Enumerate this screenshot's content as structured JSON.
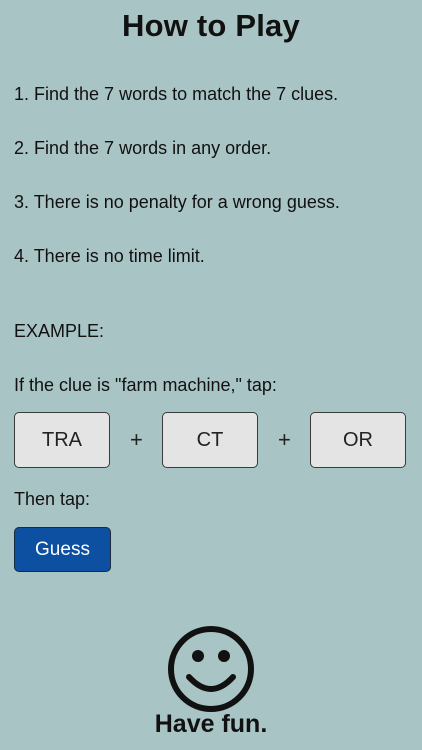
{
  "title": "How to Play",
  "rules": [
    "1. Find the 7 words to match the 7 clues.",
    "2. Find the 7 words in any order.",
    "3. There is no penalty for a wrong guess.",
    "4. There is no time limit."
  ],
  "example": {
    "heading": "EXAMPLE:",
    "clue_line": "If the clue is \"farm machine,\" tap:",
    "tiles": [
      "TRA",
      "CT",
      "OR"
    ],
    "plus": "+",
    "then_tap": "Then tap:",
    "guess_label": "Guess"
  },
  "footer": {
    "icon": "smiley-icon",
    "text": "Have fun."
  },
  "colors": {
    "background": "#a9c4c5",
    "tile": "#e4e4e4",
    "guess_button": "#0d4fa0"
  }
}
